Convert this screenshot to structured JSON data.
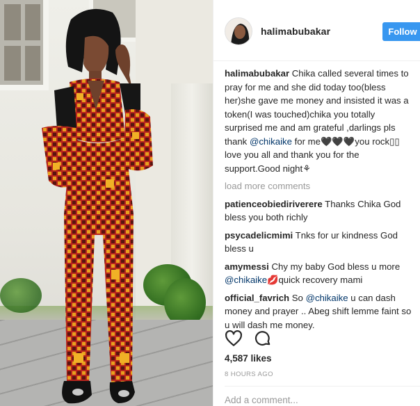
{
  "post": {
    "author": "halimabubakar",
    "follow_label": "Follow"
  },
  "caption": {
    "user": "halimabubakar",
    "text_before": " Chika called several times to pray for me and she did today too(bless her)she gave me money and insisted it was a token(I was touched)chika you totally surprised me and am grateful ,darlings pls thank ",
    "mention": "@chikaike",
    "text_after": " for me🖤🖤🖤you rock▯▯ love you all and thank you for the support.Good night⚘"
  },
  "load_more": "load more comments",
  "comments": [
    {
      "user": "patienceobiediriverere",
      "text_before": " Thanks Chika God bless you both richly",
      "mention": "",
      "text_after": ""
    },
    {
      "user": "psycadelicmimi",
      "text_before": " Tnks for ur kindness God bless u",
      "mention": "",
      "text_after": ""
    },
    {
      "user": "amymessi",
      "text_before": " Chy my baby God bless u more ",
      "mention": "@chikaike",
      "text_after": "💋quick recovery mami"
    },
    {
      "user": "official_favrich",
      "text_before": " So ",
      "mention": "@chikaike",
      "text_after": " u can dash money and prayer .. Abeg shift lemme faint so u will dash me money."
    }
  ],
  "likes": "4,587 likes",
  "time": "8 HOURS AGO",
  "add_comment_placeholder": "Add a comment...",
  "icons": {
    "like": "heart-icon",
    "comment": "comment-bubble-icon"
  },
  "colors": {
    "follow_button": "#3897f0",
    "mention": "#003569",
    "muted": "#999999",
    "text": "#262626"
  }
}
